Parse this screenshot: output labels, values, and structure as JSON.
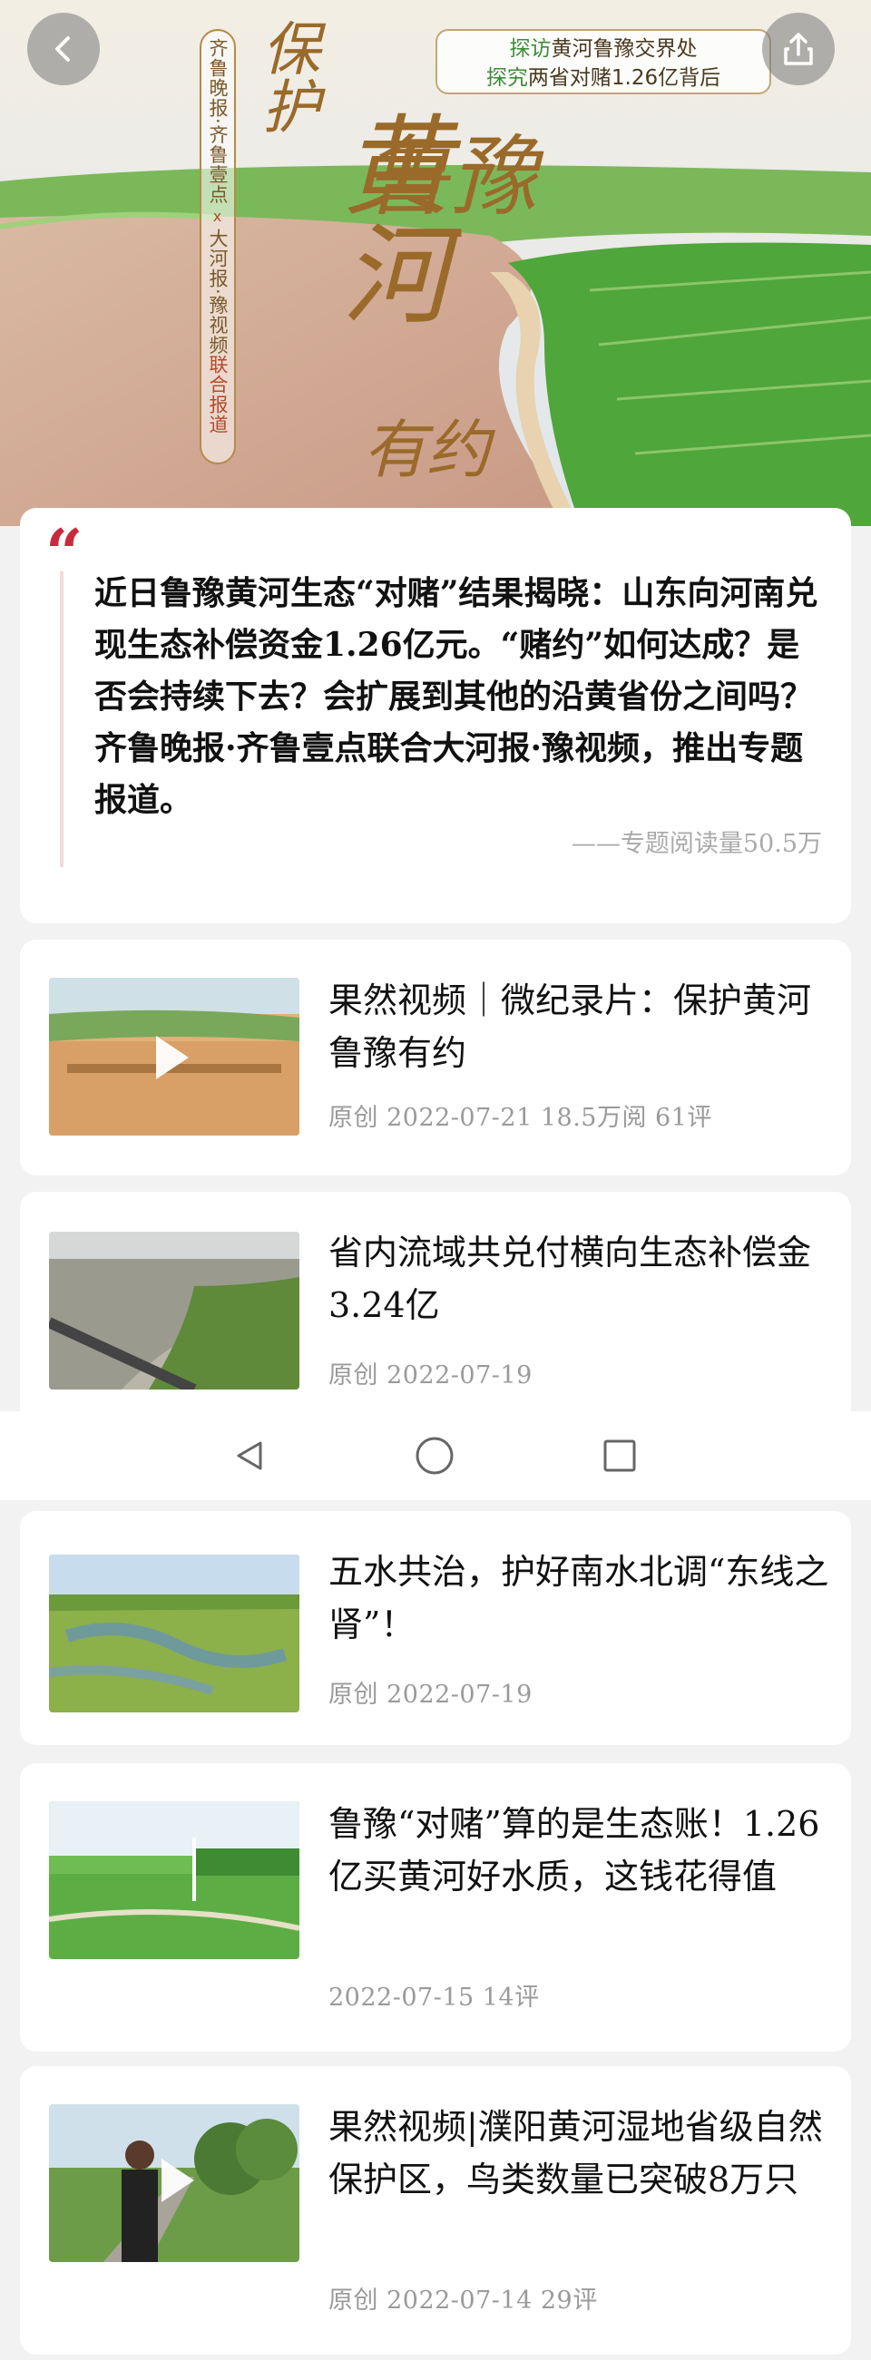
{
  "hero": {
    "back_icon": "chevron-left-icon",
    "share_icon": "share-icon",
    "vertical_outlets": [
      "齐鲁晚报·齐鲁壹点",
      "x",
      "大河报·豫视频",
      "联合报道"
    ],
    "banner_line1_accent": "探访",
    "banner_line1_rest": "黄河鲁豫交界处",
    "banner_line2_accent": "探究",
    "banner_line2_rest": "两省对赌1.26亿背后",
    "callig_1": "保护",
    "callig_2": "黄河",
    "callig_3": "鲁豫",
    "callig_4": "有约"
  },
  "quote": {
    "mark": "“",
    "text": "近日鲁豫黄河生态“对赌”结果揭晓：山东向河南兑现生态补偿资金1.26亿元。“赌约”如何达成？是否会持续下去？会扩展到其他的沿黄省份之间吗？齐鲁晚报·齐鲁壹点联合大河报·豫视频，推出专题报道。",
    "reads": "——专题阅读量50.5万"
  },
  "articles": [
    {
      "title": "果然视频｜微纪录片：保护黄河 鲁豫有约",
      "meta": "原创  2022-07-21  18.5万阅  61评",
      "video": true
    },
    {
      "title": "省内流域共兑付横向生态补偿金3.24亿",
      "meta": "原创  2022-07-19",
      "video": false
    },
    {
      "title": "五水共治，护好南水北调“东线之肾”！",
      "meta": "原创  2022-07-19",
      "video": false
    },
    {
      "title": "鲁豫“对赌”算的是生态账！1.26亿买黄河好水质，这钱花得值",
      "meta": "2022-07-15  14评",
      "video": false
    },
    {
      "title": "果然视频|濮阳黄河湿地省级自然保护区，鸟类数量已突破8万只",
      "meta": "原创  2022-07-14  29评",
      "video": true
    }
  ],
  "navbar": {
    "back": "triangle-back-icon",
    "home": "circle-home-icon",
    "recents": "square-recents-icon"
  },
  "colors": {
    "accent_red": "#c8293b",
    "banner_green": "#3f8a3a",
    "bg": "#f2f2f2"
  }
}
